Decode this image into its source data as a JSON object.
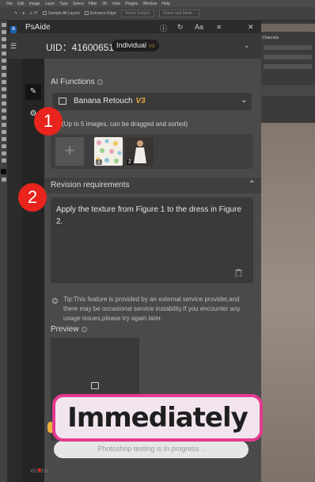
{
  "photoshop": {
    "menu": [
      "File",
      "Edit",
      "Image",
      "Layer",
      "Type",
      "Select",
      "Filter",
      "3D",
      "View",
      "Plugins",
      "Window",
      "Help"
    ],
    "options": {
      "sample_all_layers": "Sample All Layers",
      "enhance_edge": "Enhance Edge",
      "select_subject": "Select Subject",
      "select_and_mask": "Select and Mask..."
    },
    "right_panel_tab": "Channels"
  },
  "plugin": {
    "title": "PsAide",
    "uid": "UID：416006514",
    "badge": "Individual",
    "badge_sub": "V3",
    "ai_functions_label": "AI Functions",
    "selected_function": "Banana Retouch",
    "function_version": "V3",
    "upload_label": "Set(Up to 5 images, can be dragged and sorted)",
    "thumbs": [
      "1",
      "2"
    ],
    "revision_label": "Revision requirements",
    "revision_text": "Apply the texture from Figure 1 to the dress in Figure 2.",
    "tip": "Tip:This feature is provided by an external service provider,and there may be occasional service instability.If you encounter any usage issues,please try again later.",
    "preview_label": "Preview",
    "overlay_text": "Immediately",
    "progress_text": "Photoshop testing is in progress ..",
    "version": "V2.5.2.0"
  },
  "annotations": {
    "step1": "1",
    "step2": "2"
  },
  "colors": {
    "accent_red": "#e8241c",
    "v3_gold": "#e2a640",
    "overlay_pink": "#e23a8f"
  }
}
